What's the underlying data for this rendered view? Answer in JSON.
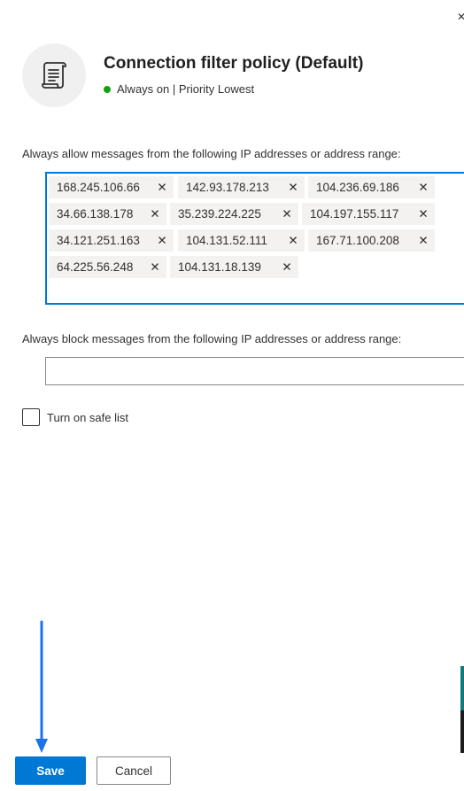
{
  "header": {
    "close_glyph": "✕",
    "icon": "policy-scroll-icon",
    "title": "Connection filter policy (Default)",
    "status_text": "Always on | Priority Lowest",
    "status_color": "#13a10e"
  },
  "allow": {
    "label": "Always allow messages from the following IP addresses or address range:",
    "tags": [
      "168.245.106.66",
      "142.93.178.213",
      "104.236.69.186",
      "34.66.138.178",
      "35.239.224.225",
      "104.197.155.117",
      "34.121.251.163",
      "104.131.52.111",
      "167.71.100.208",
      "64.225.56.248",
      "104.131.18.139"
    ],
    "remove_glyph": "✕"
  },
  "block": {
    "label": "Always block messages from the following IP addresses or address range:",
    "value": ""
  },
  "safe_list": {
    "label": "Turn on safe list",
    "checked": false
  },
  "footer": {
    "save_label": "Save",
    "cancel_label": "Cancel"
  },
  "colors": {
    "accent": "#0078d4",
    "annotation_arrow": "#1a73e8"
  }
}
